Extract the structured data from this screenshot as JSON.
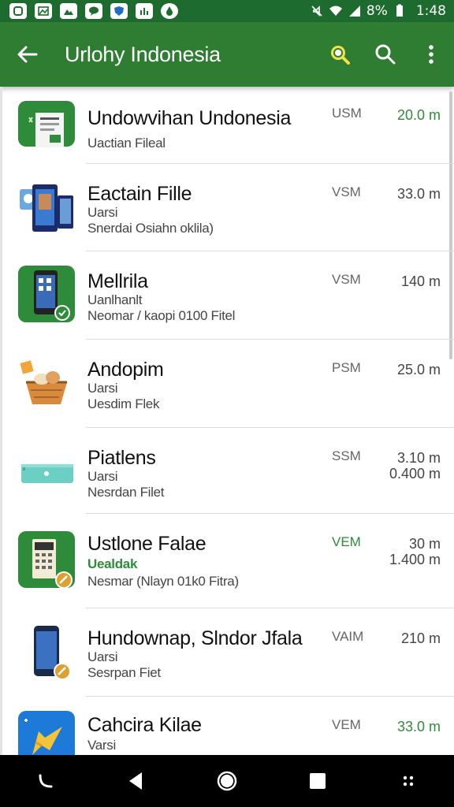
{
  "status_bar": {
    "battery": "8%",
    "time": "1:48",
    "left_icons": [
      "message-icon",
      "image-icon",
      "gallery-icon",
      "chat-icon",
      "shield-icon",
      "chart-icon",
      "drop-icon"
    ],
    "right_icons": [
      "mute-icon",
      "wifi-icon",
      "signal-icon",
      "battery-icon"
    ]
  },
  "app_bar": {
    "title": "Urlohy Indonesia",
    "actions": [
      "magnify-badge-icon",
      "search-icon",
      "more-vert-icon"
    ]
  },
  "colors": {
    "primary": "#2e7d32",
    "status": "#1d6b2e",
    "accent": "#2e8b3a"
  },
  "items": [
    {
      "title": "Undowvihan Undonesia",
      "line1": "Uactian Fileal",
      "line2": "",
      "tag": "USM",
      "size": "20.0 m",
      "size2": "",
      "tag_green": false,
      "size_green": true,
      "icon": "document-app-icon"
    },
    {
      "title": "Eactain Fille",
      "line1": "Uarsi",
      "line2": "Snerdai Osiahn oklila)",
      "tag": "VSM",
      "size": "33.0 m",
      "size2": "",
      "tag_green": false,
      "size_green": false,
      "icon": "devices-icon"
    },
    {
      "title": "Mellrila",
      "line1": "Uanlhanlt",
      "line2": "Neomar / kaopi 0100 Fitel",
      "tag": "VSM",
      "size": "140 m",
      "size2": "",
      "tag_green": false,
      "size_green": false,
      "icon": "phone-app-icon"
    },
    {
      "title": "Andopim",
      "line1": "Uarsi",
      "line2": "Uesdim Flek",
      "tag": "PSM",
      "size": "25.0 m",
      "size2": "",
      "tag_green": false,
      "size_green": false,
      "icon": "basket-icon"
    },
    {
      "title": "Piatlens",
      "line1": "Uarsi",
      "line2": "Nesrdan Filet",
      "tag": "SSM",
      "size": "3.10 m",
      "size2": "0.400 m",
      "tag_green": false,
      "size_green": false,
      "icon": "tablet-icon"
    },
    {
      "title": "Ustlone Falae",
      "line1": "Uealdak",
      "line2": "Nesmar (Nlayn 01k0 Fitra)",
      "tag": "VEM",
      "size": "30 m",
      "size2": "1.400 m",
      "tag_green": true,
      "size_green": false,
      "icon": "calculator-app-icon"
    },
    {
      "title": "Hundownap, Slndor Jfala",
      "line1": "Uarsi",
      "line2": "Sesrpan Fiet",
      "tag": "VAIM",
      "size": "210 m",
      "size2": "",
      "tag_green": false,
      "size_green": false,
      "icon": "smartphone-icon"
    },
    {
      "title": "Cahcira Kilae",
      "line1": "Varsi",
      "line2": "",
      "tag": "VEM",
      "size": "33.0 m",
      "size2": "",
      "tag_green": false,
      "size_green": true,
      "icon": "rocket-app-icon"
    }
  ],
  "nav_bar": {
    "buttons": [
      "assist-icon",
      "back-triangle-icon",
      "home-circle-icon",
      "recents-square-icon",
      "dots-grid-icon"
    ]
  }
}
